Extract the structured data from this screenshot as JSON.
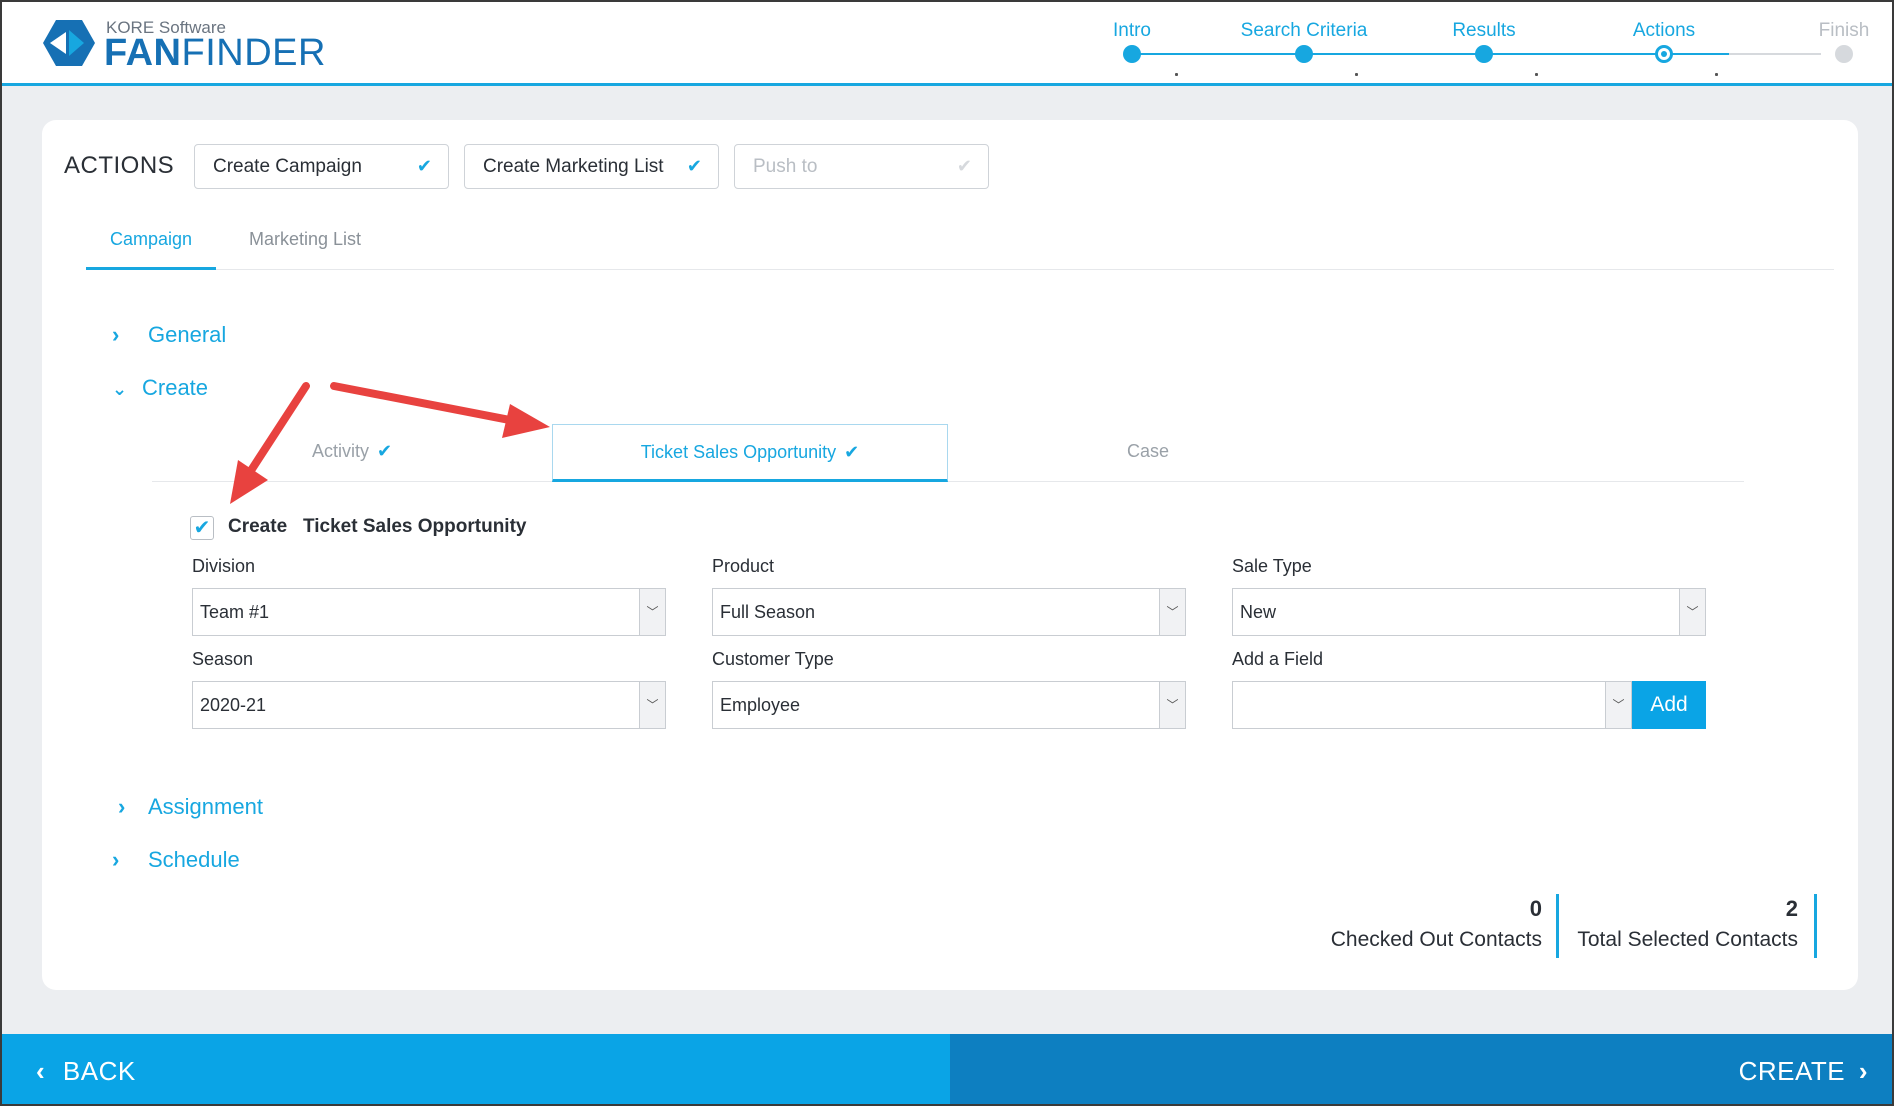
{
  "logo": {
    "company": "KORE Software",
    "product_bold": "FAN",
    "product_light": "FINDER"
  },
  "stepper": {
    "steps": [
      {
        "label": "Intro",
        "state": "done"
      },
      {
        "label": "Search Criteria",
        "state": "done"
      },
      {
        "label": "Results",
        "state": "done"
      },
      {
        "label": "Actions",
        "state": "current"
      },
      {
        "label": "Finish",
        "state": "upcoming"
      }
    ]
  },
  "actions": {
    "title": "ACTIONS",
    "buttons": [
      {
        "label": "Create Campaign",
        "checked": true
      },
      {
        "label": "Create Marketing List",
        "checked": true
      },
      {
        "label": "Push to",
        "checked": false
      }
    ],
    "check_glyph": "✔"
  },
  "tabs": [
    {
      "label": "Campaign",
      "active": true
    },
    {
      "label": "Marketing List",
      "active": false
    }
  ],
  "sections": {
    "general": "General",
    "create": "Create",
    "assignment": "Assignment",
    "schedule": "Schedule"
  },
  "subtabs": [
    {
      "label": "Activity",
      "checked": true,
      "active": false
    },
    {
      "label": "Ticket Sales Opportunity",
      "checked": true,
      "active": true
    },
    {
      "label": "Case",
      "checked": false,
      "active": false
    }
  ],
  "create_checkbox": {
    "checked": true,
    "label_prefix": "Create",
    "label_subject": "Ticket Sales Opportunity"
  },
  "form": {
    "division": {
      "label": "Division",
      "value": "Team #1"
    },
    "product": {
      "label": "Product",
      "value": "Full Season"
    },
    "sale_type": {
      "label": "Sale Type",
      "value": "New"
    },
    "season": {
      "label": "Season",
      "value": "2020-21"
    },
    "customer_type": {
      "label": "Customer Type",
      "value": "Employee"
    },
    "add_field": {
      "label": "Add a Field",
      "value": "",
      "button": "Add"
    }
  },
  "stats": {
    "checked_out": {
      "value": "0",
      "label": "Checked Out Contacts"
    },
    "total_selected": {
      "value": "2",
      "label": "Total Selected Contacts"
    }
  },
  "footer": {
    "back": "BACK",
    "create": "CREATE"
  },
  "colors": {
    "accent": "#17a7e0",
    "brand_blue": "#1670b4",
    "back_button": "#0aa4e6",
    "create_button": "#0d7fc1",
    "annotation_arrow": "#e8423f"
  }
}
